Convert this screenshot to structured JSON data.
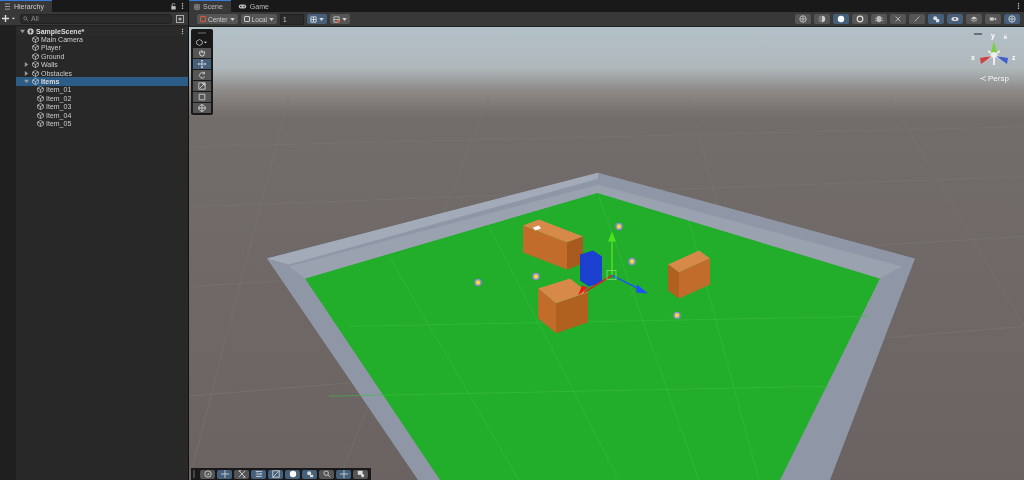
{
  "hierarchy": {
    "title": "Hierarchy",
    "search": {
      "placeholder": "All"
    },
    "scene": {
      "name": "SampleScene*",
      "expanded": true
    },
    "items": [
      {
        "label": "Main Camera",
        "selected": false
      },
      {
        "label": "Player",
        "selected": false
      },
      {
        "label": "Ground",
        "selected": false
      },
      {
        "label": "Walls",
        "expanded": false,
        "selected": false
      },
      {
        "label": "Obstacles",
        "expanded": false,
        "selected": false
      },
      {
        "label": "Items",
        "expanded": true,
        "selected": true,
        "children": [
          {
            "label": "Item_01",
            "selected": false
          },
          {
            "label": "Item_02",
            "selected": false
          },
          {
            "label": "Item_03",
            "selected": false
          },
          {
            "label": "Item_04",
            "selected": false
          },
          {
            "label": "Item_05",
            "selected": false
          }
        ]
      }
    ]
  },
  "tabs": [
    {
      "label": "Scene",
      "kind": "scene",
      "selected": true
    },
    {
      "label": "Game",
      "kind": "game",
      "selected": false
    }
  ],
  "toolbar": {
    "pivot": "Center",
    "space": "Local",
    "snap": "1",
    "right_buttons": [
      {
        "kind": "grid",
        "selected": false
      },
      {
        "kind": "shaded",
        "selected": false
      },
      {
        "kind": "solid",
        "selected": true
      },
      {
        "kind": "ring",
        "selected": false
      },
      {
        "kind": "fx",
        "selected": false
      },
      {
        "kind": "cross",
        "selected": false
      },
      {
        "kind": "line",
        "selected": false
      },
      {
        "kind": "light",
        "selected": true
      },
      {
        "kind": "eye",
        "selected": true
      },
      {
        "kind": "layers",
        "selected": false
      },
      {
        "kind": "camera",
        "selected": false
      },
      {
        "kind": "gizmo",
        "selected": true
      }
    ]
  },
  "tools": [
    {
      "kind": "hand",
      "selected": false
    },
    {
      "kind": "move",
      "selected": true
    },
    {
      "kind": "rotate",
      "selected": false
    },
    {
      "kind": "scale",
      "selected": false
    },
    {
      "kind": "rect",
      "selected": false
    },
    {
      "kind": "transform",
      "selected": false
    }
  ],
  "overlay_tools": [
    {
      "kind": "compass",
      "selected": false
    },
    {
      "kind": "move",
      "selected": true
    },
    {
      "kind": "scale",
      "selected": false
    },
    {
      "kind": "sliders",
      "selected": true
    },
    {
      "kind": "image",
      "selected": true
    },
    {
      "kind": "solid",
      "selected": true
    },
    {
      "kind": "light",
      "selected": true
    },
    {
      "kind": "search",
      "selected": false
    },
    {
      "kind": "move",
      "selected": true
    },
    {
      "kind": "camera",
      "selected": false
    }
  ],
  "orientation": {
    "y": "y",
    "x": "x",
    "z": "z",
    "projection": "Persp"
  }
}
